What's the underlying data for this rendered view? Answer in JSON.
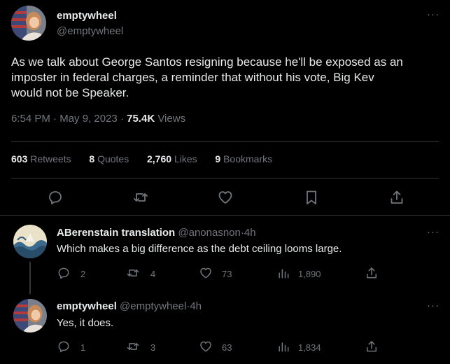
{
  "main_tweet": {
    "display_name": "emptywheel",
    "handle": "@emptywheel",
    "more": "···",
    "text_lines": [
      "As we talk about George Santos resigning because he'll be exposed as an",
      "imposter in federal charges, a reminder that without his vote, Big Kev",
      "would not be Speaker."
    ],
    "time": "6:54 PM",
    "sep1": "·",
    "date": "May 9, 2023",
    "sep2": "·",
    "views_count": "75.4K",
    "views_label": "Views",
    "stats": [
      {
        "count": "603",
        "label": "Retweets"
      },
      {
        "count": "8",
        "label": "Quotes"
      },
      {
        "count": "2,760",
        "label": "Likes"
      },
      {
        "count": "9",
        "label": "Bookmarks"
      }
    ]
  },
  "replies": [
    {
      "display_name": "ABerenstain translation",
      "handle": "@anonasnon",
      "sep": "·",
      "time": "4h",
      "more": "···",
      "text": "Which makes a big difference as the debt ceiling looms large.",
      "replies": "2",
      "retweets": "4",
      "likes": "73",
      "views": "1,890"
    },
    {
      "display_name": "emptywheel",
      "handle": "@emptywheel",
      "sep": "·",
      "time": "4h",
      "more": "···",
      "text": "Yes, it does.",
      "replies": "1",
      "retweets": "3",
      "likes": "63",
      "views": "1,834"
    }
  ],
  "colors": {
    "background": "#000000",
    "text": "#e7e9ea",
    "secondary": "#71767b",
    "divider": "#2f3336"
  }
}
